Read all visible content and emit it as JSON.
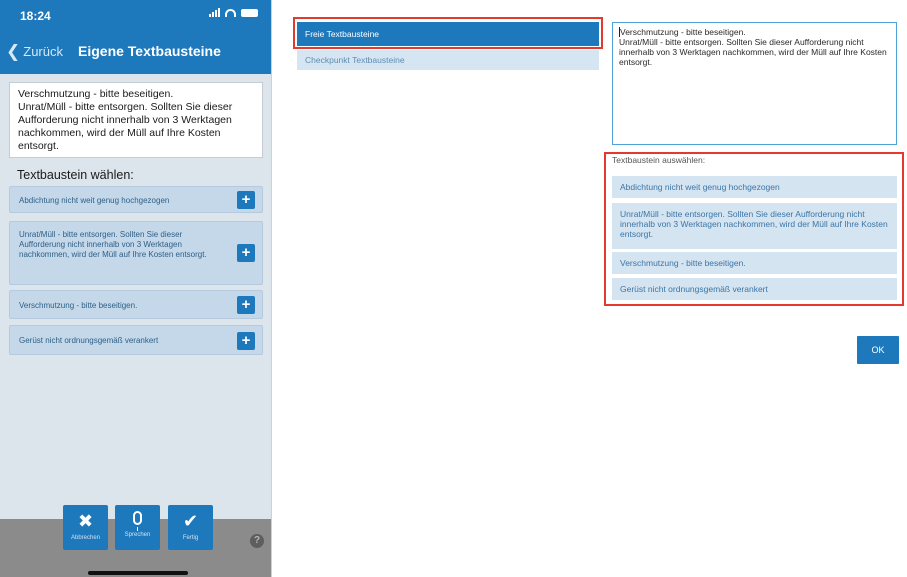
{
  "phone": {
    "status_time": "18:24",
    "nav": {
      "back_label": "Zurück",
      "title": "Eigene Textbausteine"
    },
    "preview_text": "Verschmutzung - bitte beseitigen.\nUnrat/Müll - bitte entsorgen. Sollten Sie dieser Aufforderung nicht innerhalb von 3 Werktagen nachkommen, wird der Müll auf Ihre Kosten entsorgt.",
    "pick_label": "Textbaustein wählen:",
    "items": [
      {
        "label": "Abdichtung nicht weit genug hochgezogen",
        "add": "+"
      },
      {
        "label": "Unrat/Müll - bitte entsorgen. Sollten Sie dieser Aufforderung nicht innerhalb von 3 Werktagen nachkommen, wird der Müll auf Ihre Kosten entsorgt.",
        "add": "+"
      },
      {
        "label": "Verschmutzung - bitte beseitigen.",
        "add": "+"
      },
      {
        "label": "Gerüst nicht ordnungsgemäß verankert",
        "add": "+"
      }
    ],
    "toolbar": {
      "cancel_label": "Abbrechen",
      "speak_label": "Sprechen",
      "done_label": "Fertig"
    }
  },
  "desktop": {
    "tabs": [
      {
        "label": "Freie Textbausteine",
        "active": true
      },
      {
        "label": "Checkpunkt Textbausteine",
        "active": false
      }
    ],
    "textarea_value": "Verschmutzung - bitte beseitigen.\nUnrat/Müll - bitte entsorgen. Sollten Sie dieser Aufforderung nicht innerhalb von 3 Werktagen nachkommen, wird der Müll auf Ihre Kosten entsorgt.",
    "list_label": "Textbaustein auswählen:",
    "list_items": [
      "Abdichtung nicht weit genug hochgezogen",
      "Unrat/Müll - bitte entsorgen. Sollten Sie dieser Aufforderung nicht innerhalb von 3 Werktagen nachkommen, wird der Müll auf Ihre Kosten entsorgt.",
      "Verschmutzung - bitte beseitigen.",
      "Gerüst nicht ordnungsgemäß verankert"
    ],
    "ok_label": "OK"
  },
  "colors": {
    "brand_blue": "#1d78bc",
    "item_blue": "#c4d8ea",
    "highlight_red": "#e23a2e",
    "textarea_border": "#4ea4d8"
  },
  "icons": [
    "chevron-left-icon",
    "plus-icon",
    "close-icon",
    "microphone-icon",
    "checkmark-icon",
    "help-icon"
  ]
}
